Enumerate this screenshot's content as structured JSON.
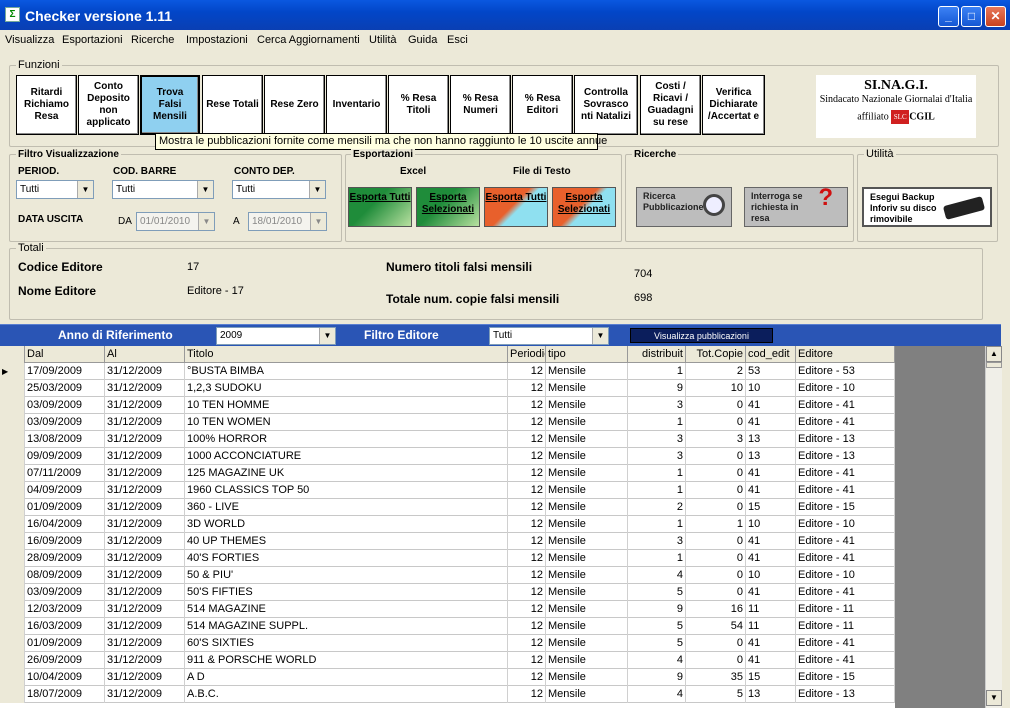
{
  "window": {
    "title": "Checker versione 1.11",
    "icon": "app-icon"
  },
  "menu": [
    "Visualizza",
    "Esportazioni",
    "Ricerche",
    "Impostazioni",
    "Cerca Aggiornamenti",
    "Utilità",
    "Guida",
    "Esci"
  ],
  "funzioni": {
    "group_label": "Funzioni",
    "buttons": [
      {
        "label": "Ritardi Richiamo Resa"
      },
      {
        "label": "Conto Deposito non applicato"
      },
      {
        "label": "Trova Falsi Mensili"
      },
      {
        "label": "Rese Totali"
      },
      {
        "label": "Rese Zero"
      },
      {
        "label": "Inventario"
      },
      {
        "label": "% Resa Titoli"
      },
      {
        "label": "% Resa Numeri"
      },
      {
        "label": "% Resa Editori"
      },
      {
        "label": "Controlla Sovrasco nti Natalizi"
      },
      {
        "label": "Costi / Ricavi / Guadagni su rese"
      },
      {
        "label": "Verifica Dichiarate /Accertat e"
      }
    ],
    "tooltip": "Mostra le pubblicazioni fornite come mensili ma che non hanno raggiunto le 10 uscite annue"
  },
  "logo": {
    "line1": "SI.NA.G.I.",
    "line2": "Sindacato Nazionale Giornalai d'Italia",
    "affiliato": "affiliato",
    "slc": "SLC",
    "cgil": "CGIL"
  },
  "filtro": {
    "group_label": "Filtro Visualizzazione",
    "period_label": "PERIOD.",
    "period_value": "Tutti",
    "codbarre_label": "COD. BARRE",
    "codbarre_value": "Tutti",
    "contodep_label": "CONTO DEP.",
    "contodep_value": "Tutti",
    "data_uscita_label": "DATA USCITA",
    "da_label": "DA",
    "da_value": "01/01/2010",
    "a_label": "A",
    "a_value": "18/01/2010"
  },
  "esportazioni": {
    "group_label": "Esportazioni",
    "excel_label": "Excel",
    "testo_label": "File di Testo",
    "btn1": "Esporta Tutti",
    "btn2": "Esporta Selezionati",
    "btn3": "Esporta Tutti",
    "btn4": "Esporta Selezionati",
    "excel_color": "#1f8c3a",
    "testo_color": "#e8602c"
  },
  "ricerche": {
    "group_label": "Ricerche",
    "btn1": "Ricerca Pubblicazione",
    "btn2": "Interroga se richiesta in resa"
  },
  "utilita": {
    "group_label": "Utilità",
    "btn": "Esegui Backup Inforiv su disco rimovibile"
  },
  "totali": {
    "group_label": "Totali",
    "codice_label": "Codice Editore",
    "codice_value": "17",
    "nome_label": "Nome Editore",
    "nome_value": "Editore - 17",
    "num_label": "Numero titoli falsi mensili",
    "num_value": "704",
    "tot_label": "Totale num. copie falsi mensili",
    "tot_value": "698"
  },
  "bar": {
    "anno_label": "Anno di Riferimento",
    "anno_value": "2009",
    "filtro_label": "Filtro Editore",
    "filtro_value": "Tutti",
    "visualizza_btn": "Visualizza pubblicazioni"
  },
  "table": {
    "columns": [
      "Dal",
      "Al",
      "Titolo",
      "Periodic",
      "tipo",
      "distribuit",
      "Tot.Copie",
      "cod_edit",
      "Editore"
    ],
    "rows": [
      [
        "17/09/2009",
        "31/12/2009",
        "°BUSTA BIMBA",
        "12",
        "Mensile",
        "1",
        "2",
        "53",
        "Editore - 53"
      ],
      [
        "25/03/2009",
        "31/12/2009",
        "1,2,3 SUDOKU",
        "12",
        "Mensile",
        "9",
        "10",
        "10",
        "Editore - 10"
      ],
      [
        "03/09/2009",
        "31/12/2009",
        "10 TEN HOMME",
        "12",
        "Mensile",
        "3",
        "0",
        "41",
        "Editore - 41"
      ],
      [
        "03/09/2009",
        "31/12/2009",
        "10 TEN WOMEN",
        "12",
        "Mensile",
        "1",
        "0",
        "41",
        "Editore - 41"
      ],
      [
        "13/08/2009",
        "31/12/2009",
        "100% HORROR",
        "12",
        "Mensile",
        "3",
        "3",
        "13",
        "Editore - 13"
      ],
      [
        "09/09/2009",
        "31/12/2009",
        "1000 ACCONCIATURE",
        "12",
        "Mensile",
        "3",
        "0",
        "13",
        "Editore - 13"
      ],
      [
        "07/11/2009",
        "31/12/2009",
        "125 MAGAZINE UK",
        "12",
        "Mensile",
        "1",
        "0",
        "41",
        "Editore - 41"
      ],
      [
        "04/09/2009",
        "31/12/2009",
        "1960 CLASSICS TOP 50",
        "12",
        "Mensile",
        "1",
        "0",
        "41",
        "Editore - 41"
      ],
      [
        "01/09/2009",
        "31/12/2009",
        "360 - LIVE",
        "12",
        "Mensile",
        "2",
        "0",
        "15",
        "Editore - 15"
      ],
      [
        "16/04/2009",
        "31/12/2009",
        "3D WORLD",
        "12",
        "Mensile",
        "1",
        "1",
        "10",
        "Editore - 10"
      ],
      [
        "16/09/2009",
        "31/12/2009",
        "40 UP THEMES",
        "12",
        "Mensile",
        "3",
        "0",
        "41",
        "Editore - 41"
      ],
      [
        "28/09/2009",
        "31/12/2009",
        "40'S FORTIES",
        "12",
        "Mensile",
        "1",
        "0",
        "41",
        "Editore - 41"
      ],
      [
        "08/09/2009",
        "31/12/2009",
        "50 & PIU'",
        "12",
        "Mensile",
        "4",
        "0",
        "10",
        "Editore - 10"
      ],
      [
        "03/09/2009",
        "31/12/2009",
        "50'S FIFTIES",
        "12",
        "Mensile",
        "5",
        "0",
        "41",
        "Editore - 41"
      ],
      [
        "12/03/2009",
        "31/12/2009",
        "514 MAGAZINE",
        "12",
        "Mensile",
        "9",
        "16",
        "11",
        "Editore - 11"
      ],
      [
        "16/03/2009",
        "31/12/2009",
        "514 MAGAZINE SUPPL.",
        "12",
        "Mensile",
        "5",
        "54",
        "11",
        "Editore - 11"
      ],
      [
        "01/09/2009",
        "31/12/2009",
        "60'S SIXTIES",
        "12",
        "Mensile",
        "5",
        "0",
        "41",
        "Editore - 41"
      ],
      [
        "26/09/2009",
        "31/12/2009",
        "911 & PORSCHE WORLD",
        "12",
        "Mensile",
        "4",
        "0",
        "41",
        "Editore - 41"
      ],
      [
        "10/04/2009",
        "31/12/2009",
        "A D",
        "12",
        "Mensile",
        "9",
        "35",
        "15",
        "Editore - 15"
      ],
      [
        "18/07/2009",
        "31/12/2009",
        "A.B.C.",
        "12",
        "Mensile",
        "4",
        "5",
        "13",
        "Editore - 13"
      ]
    ]
  }
}
